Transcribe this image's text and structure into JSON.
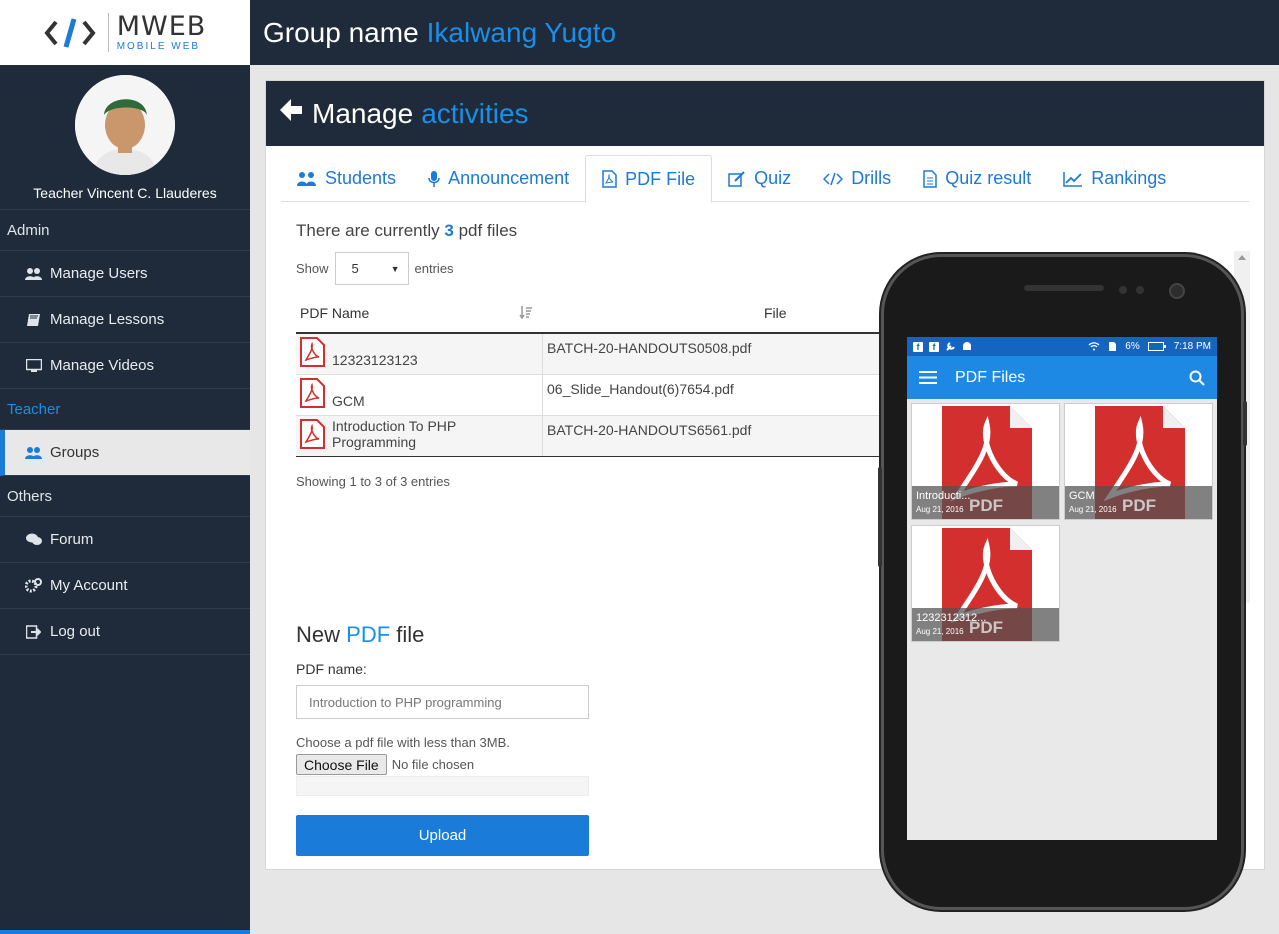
{
  "logo": {
    "title": "MWEB",
    "subtitle": "MOBILE WEB"
  },
  "profile": {
    "name": "Teacher Vincent C. Llauderes"
  },
  "sidebar": {
    "sections": {
      "admin": "Admin",
      "teacher": "Teacher",
      "others": "Others"
    },
    "items": [
      {
        "label": "Manage Users",
        "icon": "users-icon"
      },
      {
        "label": "Manage Lessons",
        "icon": "book-icon"
      },
      {
        "label": "Manage Videos",
        "icon": "monitor-icon"
      },
      {
        "label": "Groups",
        "icon": "users-icon"
      },
      {
        "label": "Forum",
        "icon": "comments-icon"
      },
      {
        "label": "My Account",
        "icon": "gears-icon"
      },
      {
        "label": "Log out",
        "icon": "logout-icon"
      }
    ]
  },
  "header": {
    "prefix": "Group name",
    "group": "Ikalwang Yugto"
  },
  "card": {
    "title_prefix": "Manage",
    "title_accent": "activities",
    "tabs": [
      {
        "label": "Students",
        "icon": "users-icon"
      },
      {
        "label": "Announcement",
        "icon": "microphone-icon"
      },
      {
        "label": "PDF File",
        "icon": "pdf-file-icon"
      },
      {
        "label": "Quiz",
        "icon": "edit-icon"
      },
      {
        "label": "Drills",
        "icon": "code-icon"
      },
      {
        "label": "Quiz result",
        "icon": "document-icon"
      },
      {
        "label": "Rankings",
        "icon": "line-chart-icon"
      }
    ],
    "count_prefix": "There are currently",
    "count": "3",
    "count_suffix": "pdf files",
    "show_label": "Show",
    "entries_value": "5",
    "entries_label": "entries",
    "table": {
      "headers": {
        "name": "PDF Name",
        "file": "File"
      },
      "rows": [
        {
          "name": "12323123123",
          "file": "BATCH-20-HANDOUTS0508.pdf"
        },
        {
          "name": "GCM",
          "file": "06_Slide_Handout(6)7654.pdf"
        },
        {
          "name": "Introduction To PHP Programming",
          "file": "BATCH-20-HANDOUTS6561.pdf"
        }
      ]
    },
    "showing": "Showing 1 to 3 of 3 entries",
    "form": {
      "title_prefix": "New",
      "title_accent": "PDF",
      "title_suffix": "file",
      "name_label": "PDF name:",
      "name_value": "Introduction to PHP programming",
      "choose_text": "Choose a pdf file with less than 3MB.",
      "choose_button": "Choose File",
      "no_file": "No file chosen",
      "upload": "Upload"
    }
  },
  "phone": {
    "status": {
      "battery": "6%",
      "time": "7:18 PM"
    },
    "appbar_title": "PDF Files",
    "tiles": [
      {
        "title": "Introducti...",
        "date": "Aug 21, 2016",
        "label": "PDF"
      },
      {
        "title": "GCM",
        "date": "Aug 21, 2016",
        "label": "PDF"
      },
      {
        "title": "1232312312...",
        "date": "Aug 21, 2016",
        "label": "PDF"
      }
    ]
  },
  "colors": {
    "accent": "#1a7bd8",
    "sidebar": "#1f2b3a",
    "pdf_red": "#d32f2f"
  }
}
